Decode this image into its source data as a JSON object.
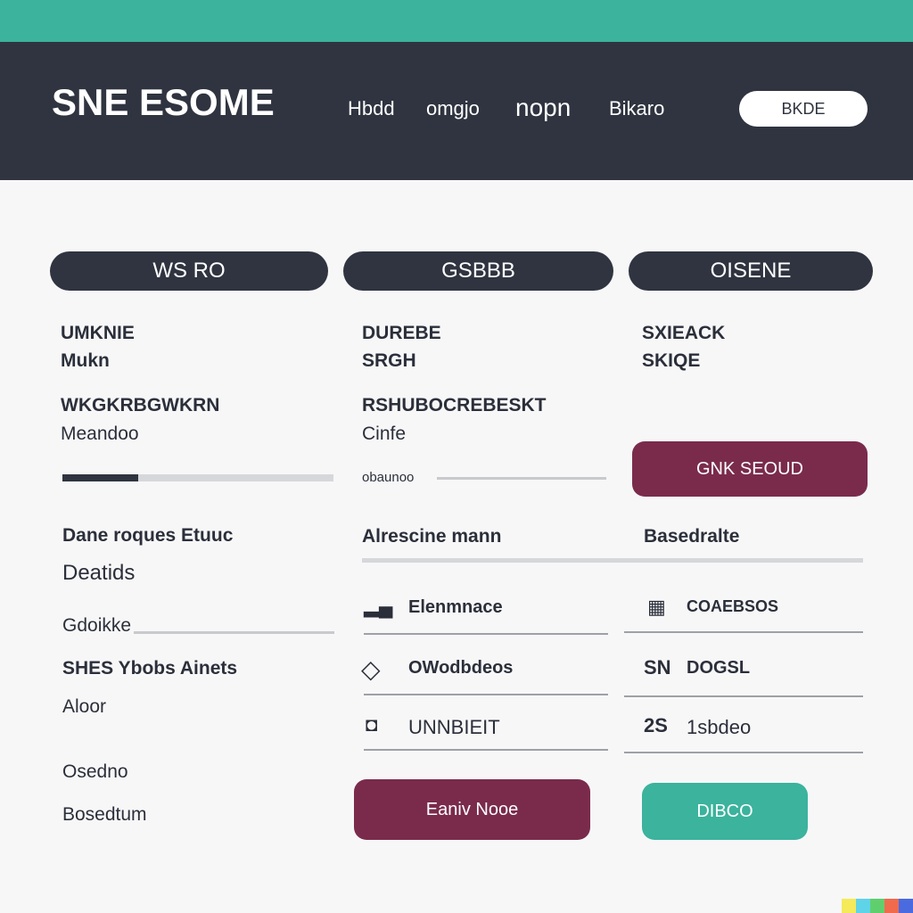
{
  "header": {
    "logo": "SNE ESOME",
    "nav": [
      "Hbdd",
      "omgjo",
      "nopn",
      "Bikaro"
    ],
    "button_label": "BKDE"
  },
  "columns": [
    {
      "title": "WS RO",
      "heading_1": "UMKNIE",
      "heading_1b": "Mukn",
      "heading_2": "WKGKRBGWKRN",
      "heading_2b": "Meandoo",
      "progress": 0.28,
      "section_1": "Dane roques Etuuc",
      "section_1b": "Deatids",
      "field_label": "Gdoikke",
      "section_2": "SHES Ybobs Ainets",
      "section_2b": "Aloor",
      "footer_1": "Osedno",
      "footer_2": "Bosedtum"
    },
    {
      "title": "GSBBB",
      "heading_1": "DUREBE",
      "heading_1b": "SRGH",
      "heading_2": "RSHUBOCREBESKT",
      "heading_2b": "Cinfe",
      "progress_label": "obaunoo",
      "section_1": "Alrescine mann",
      "rows": [
        {
          "icon": "chart-icon",
          "glyph": "▂▄",
          "label": "Elenmnace"
        },
        {
          "icon": "diamond-icon",
          "glyph": "◇",
          "label": "OWodbdeos"
        },
        {
          "icon": "shield-icon",
          "glyph": "◘",
          "label": "UNNBIEIT"
        }
      ],
      "button_label": "Eaniv Nooe"
    },
    {
      "title": "OISENE",
      "heading_1": "SXIEACK",
      "heading_1b": "SKIQE",
      "button_top_label": "GNK SEOUD",
      "section_1": "Basedralte",
      "rows": [
        {
          "icon": "calendar-icon",
          "glyph": "▦",
          "label": "COAEBSOS"
        },
        {
          "icon": "text-icon",
          "glyph": "SN",
          "label": "DOGSL"
        },
        {
          "icon": "number-icon",
          "glyph": "2S",
          "label": "1sbdeo"
        }
      ],
      "button_label": "DIBCO"
    }
  ],
  "colors": {
    "accent_teal": "#3bb39d",
    "header_dark": "#2f3440",
    "maroon": "#7a2b4c"
  },
  "corner_colors": [
    "#f5ea5a",
    "#5fd3e8",
    "#5fcf6e",
    "#f06a4d",
    "#4a6ae0"
  ]
}
